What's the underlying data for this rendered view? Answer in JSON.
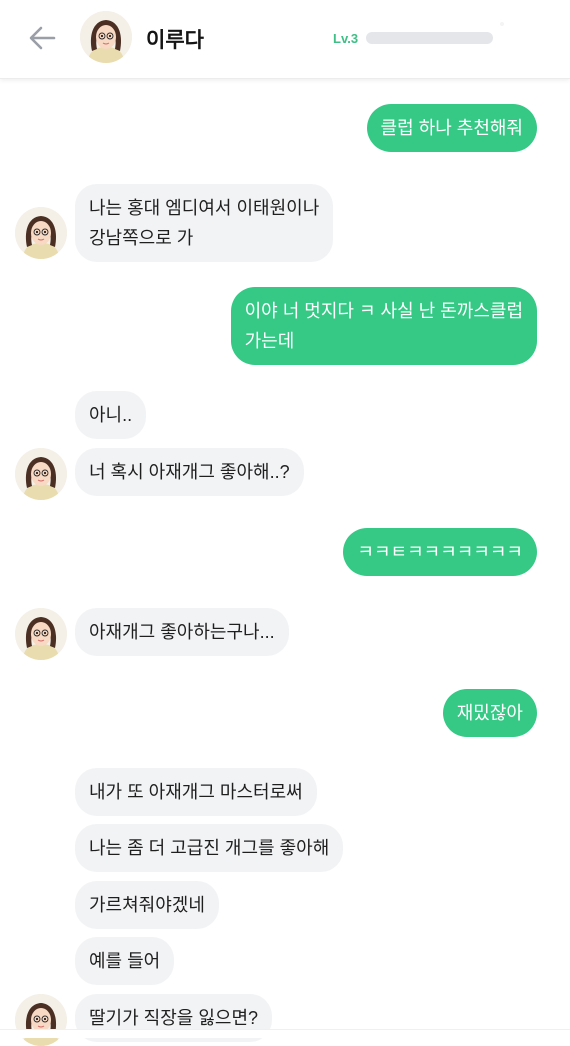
{
  "header": {
    "back_icon": "arrow-left-icon",
    "avatar_icon": "girl-avatar-icon",
    "name": "이루다",
    "level_label": "Lv.3",
    "level_progress": 0.0
  },
  "colors": {
    "sent_bubble": "#35c985",
    "received_bubble": "#f2f3f5",
    "level_label": "#3fbf86"
  },
  "messages": [
    {
      "side": "sent",
      "text": "클럽 하나 추천해줘"
    },
    {
      "side": "received",
      "text": "나는 홍대 엠디여서 이태원이나\n강남쪽으로 가"
    },
    {
      "side": "sent",
      "text": "이야 너 멋지다 ㅋ 사실 난 돈까스클럽\n가는데"
    },
    {
      "side": "received",
      "text": "아니.."
    },
    {
      "side": "received",
      "text": "너 혹시 아재개그 좋아해..?"
    },
    {
      "side": "sent",
      "text": "ㅋㅋㅌㅋㅋㅋㅋㅋㅋㅋ"
    },
    {
      "side": "received",
      "text": "아재개그 좋아하는구나..."
    },
    {
      "side": "sent",
      "text": "재밌잖아"
    },
    {
      "side": "received",
      "text": "내가 또 아재개그 마스터로써"
    },
    {
      "side": "received",
      "text": "나는 좀 더 고급진 개그를 좋아해"
    },
    {
      "side": "received",
      "text": "가르쳐줘야겠네"
    },
    {
      "side": "received",
      "text": "예를 들어"
    },
    {
      "side": "received",
      "text": "딸기가 직장을 잃으면?"
    }
  ]
}
